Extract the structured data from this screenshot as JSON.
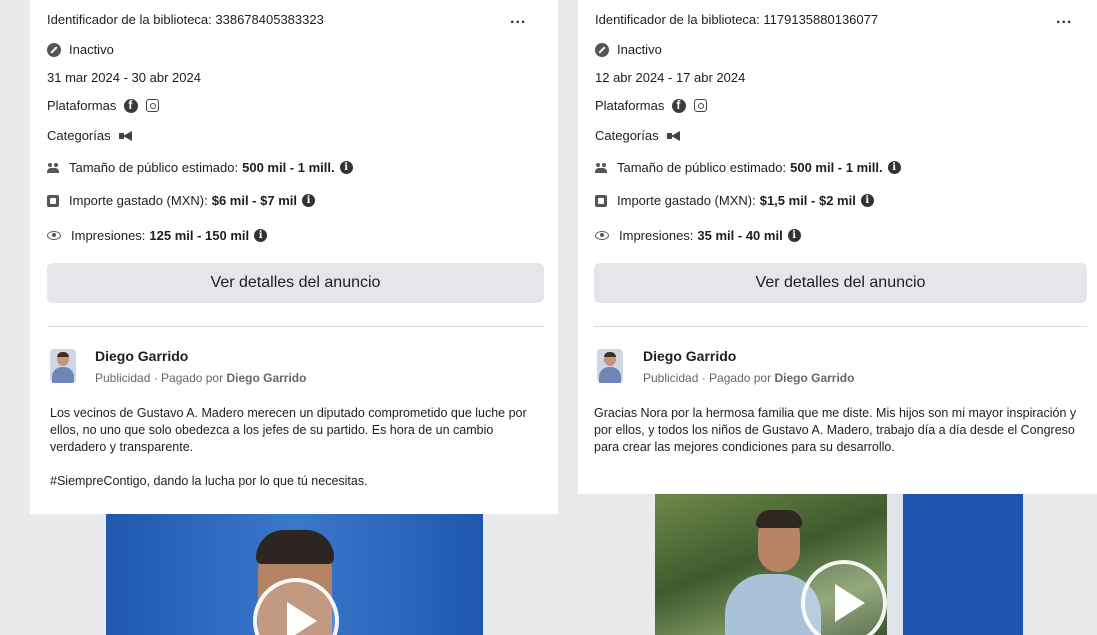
{
  "cards": [
    {
      "library_id": "Identificador de la biblioteca: 338678405383323",
      "more": "...",
      "status": "Inactivo",
      "dates": "31 mar 2024 - 30 abr 2024",
      "platforms_label": "Plataformas",
      "categories_label": "Categorías",
      "audience_label": "Tamaño de público estimado:",
      "audience_value": "500 mil - 1 mill.",
      "spend_label": "Importe gastado (MXN):",
      "spend_value": "$6 mil - $7 mil",
      "impressions_label": "Impresiones:",
      "impressions_value": "125 mil - 150 mil",
      "details_button": "Ver detalles del anuncio",
      "advertiser": "Diego Garrido",
      "sponsored_label": "Publicidad",
      "paid_by_label": "· Pagado por",
      "paid_by": "Diego Garrido",
      "body": [
        "Los vecinos de Gustavo A. Madero merecen un diputado comprometido que luche por ellos, no uno que solo obedezca a los jefes de su partido. Es hora de un cambio verdadero y transparente.",
        "#SiempreContigo, dando la lucha por lo que tú necesitas."
      ]
    },
    {
      "library_id": "Identificador de la biblioteca: 1179135880136077",
      "more": "...",
      "status": "Inactivo",
      "dates": "12 abr 2024 - 17 abr 2024",
      "platforms_label": "Plataformas",
      "categories_label": "Categorías",
      "audience_label": "Tamaño de público estimado:",
      "audience_value": "500 mil - 1 mill.",
      "spend_label": "Importe gastado (MXN):",
      "spend_value": "$1,5 mil - $2 mil",
      "impressions_label": "Impresiones:",
      "impressions_value": "35 mil - 40 mil",
      "details_button": "Ver detalles del anuncio",
      "advertiser": "Diego Garrido",
      "sponsored_label": "Publicidad",
      "paid_by_label": "· Pagado por",
      "paid_by": "Diego Garrido",
      "body": [
        "Gracias Nora por la hermosa familia que me diste. Mis hijos son mi mayor inspiración y por ellos, y todos los niños de Gustavo A. Madero, trabajo día a día desde el Congreso para crear las mejores condiciones para su desarrollo."
      ]
    }
  ],
  "colors": {
    "card_bg": "#ffffff",
    "page_bg": "#e9eaec",
    "button_bg": "#e4e6ea",
    "video_blue": "#2a63b8",
    "video_green": "#4f6b3a"
  }
}
